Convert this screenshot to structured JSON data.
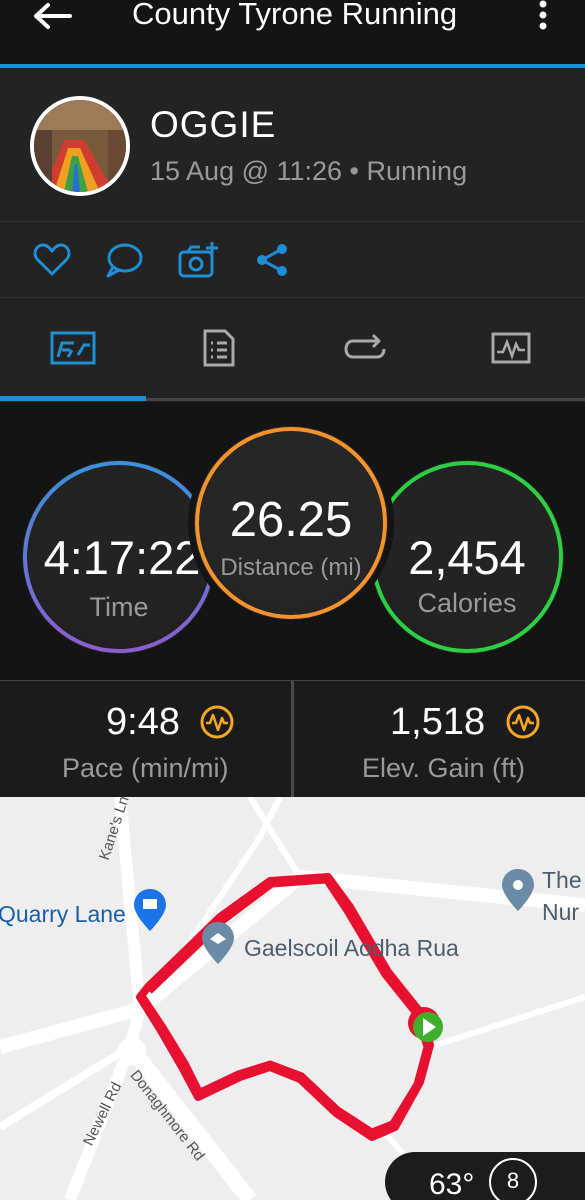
{
  "topbar": {
    "title": "County Tyrone Running",
    "back_icon": "arrow-left-icon",
    "menu_icon": "kebab-menu-icon"
  },
  "activity": {
    "user_name": "OGGIE",
    "meta": "15 Aug @ 11:26 • Running"
  },
  "actions": [
    {
      "icon": "heart-icon"
    },
    {
      "icon": "comment-icon"
    },
    {
      "icon": "add-photo-icon"
    },
    {
      "icon": "share-icon"
    }
  ],
  "tabs": [
    {
      "icon": "overview-chart-icon",
      "active": true
    },
    {
      "icon": "details-list-icon",
      "active": false
    },
    {
      "icon": "laps-loop-icon",
      "active": false
    },
    {
      "icon": "graphs-icon",
      "active": false
    }
  ],
  "stats": {
    "time": {
      "value": "4:17:22",
      "label": "Time"
    },
    "distance": {
      "value": "26.25",
      "label": "Distance (mi)"
    },
    "calories": {
      "value": "2,454",
      "label": "Calories"
    }
  },
  "metrics": {
    "pace": {
      "value": "9:48",
      "label": "Pace (min/mi)"
    },
    "elevation": {
      "value": "1,518",
      "label": "Elev. Gain (ft)"
    }
  },
  "map": {
    "labels": {
      "quarry": "Quarry Lane",
      "school": "Gaelscoil Aodha Rua",
      "kanes": "Kane's Ln",
      "newell": "Newell Rd",
      "donaghmore": "Donaghmore Rd",
      "the": "The",
      "nur": "Nur"
    },
    "weather": {
      "temp": "63°",
      "wind": "8"
    }
  },
  "colors": {
    "accent": "#1e8fd5",
    "time_ring": "#3d8fd8",
    "distance_ring": "#f5922b",
    "calories_ring": "#2ecf44",
    "route": "#e8102f",
    "metric_icon": "#f5a623"
  }
}
